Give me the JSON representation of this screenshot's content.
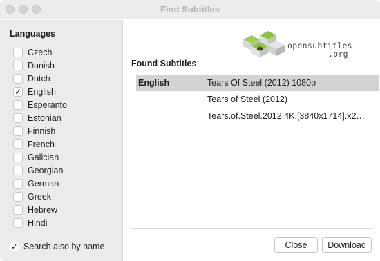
{
  "window": {
    "title": "Find Subtitles"
  },
  "sidebar": {
    "heading": "Languages",
    "languages": [
      {
        "label": "Czech",
        "checked": false
      },
      {
        "label": "Danish",
        "checked": false
      },
      {
        "label": "Dutch",
        "checked": false
      },
      {
        "label": "English",
        "checked": true
      },
      {
        "label": "Esperanto",
        "checked": false
      },
      {
        "label": "Estonian",
        "checked": false
      },
      {
        "label": "Finnish",
        "checked": false
      },
      {
        "label": "French",
        "checked": false
      },
      {
        "label": "Galician",
        "checked": false
      },
      {
        "label": "Georgian",
        "checked": false
      },
      {
        "label": "German",
        "checked": false
      },
      {
        "label": "Greek",
        "checked": false
      },
      {
        "label": "Hebrew",
        "checked": false
      },
      {
        "label": "Hindi",
        "checked": false
      }
    ],
    "search_by_name": {
      "label": "Search also by name",
      "checked": true
    }
  },
  "main": {
    "logo": {
      "line1": "opensubtitles",
      "line2": ".org"
    },
    "heading": "Found Subtitles",
    "results": [
      {
        "language": "English",
        "title": "Tears Of Steel (2012) 1080p",
        "selected": true
      },
      {
        "language": "",
        "title": "Tears of Steel (2012)",
        "selected": false
      },
      {
        "language": "",
        "title": "Tears.of.Steel.2012.4K.[3840x1714].x2…",
        "selected": false
      }
    ]
  },
  "buttons": {
    "close_label": "Close",
    "download_label": "Download"
  },
  "colors": {
    "logo_green": "#8cc63f",
    "selection": "#d3d3d3",
    "sidebar_bg": "#ebebeb"
  },
  "icons": [
    "checkmark-icon",
    "opensubtitles-logo-icon"
  ]
}
